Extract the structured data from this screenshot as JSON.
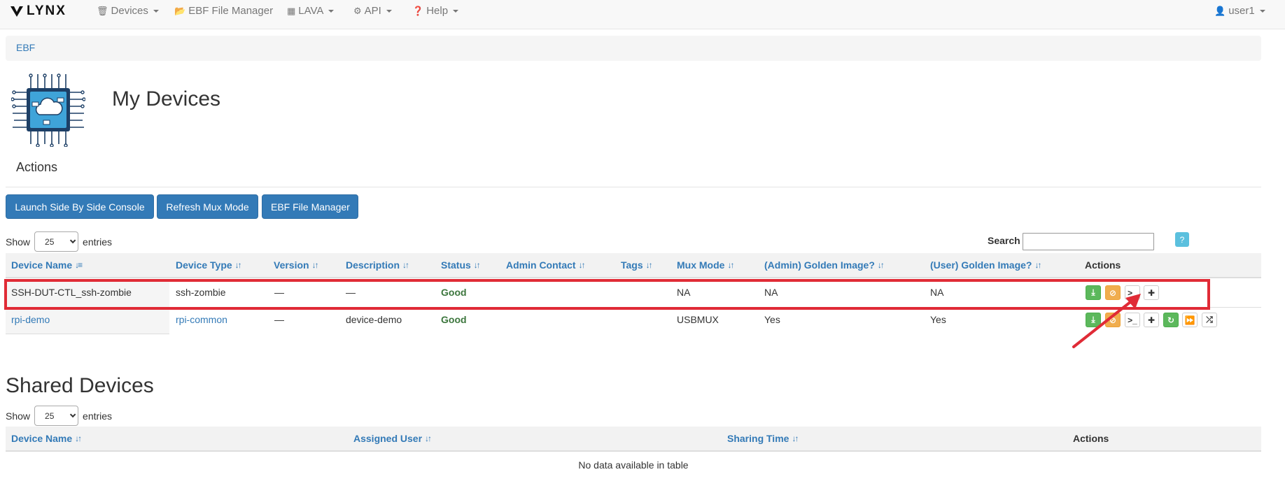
{
  "navbar": {
    "brand": "LYNX",
    "items": [
      {
        "label": "Devices",
        "icon": "trash-icon",
        "dropdown": true
      },
      {
        "label": "EBF File Manager",
        "icon": "folder-open-icon",
        "dropdown": false
      },
      {
        "label": "LAVA",
        "icon": "calendar-icon",
        "dropdown": true
      },
      {
        "label": "API",
        "icon": "gear-icon",
        "dropdown": true
      },
      {
        "label": "Help",
        "icon": "question-circle-icon",
        "dropdown": true
      }
    ],
    "user": "user1"
  },
  "breadcrumb": [
    "EBF"
  ],
  "page_title": "My Devices",
  "actions_heading": "Actions",
  "action_buttons": [
    "Launch Side By Side Console",
    "Refresh Mux Mode",
    "EBF File Manager"
  ],
  "my_devices": {
    "length_prefix": "Show",
    "length_value": "25",
    "length_suffix": "entries",
    "search_label": "Search",
    "search_value": "",
    "help_label": "?",
    "columns": [
      "Device Name",
      "Device Type",
      "Version",
      "Description",
      "Status",
      "Admin Contact",
      "Tags",
      "Mux Mode",
      "(Admin) Golden Image?",
      "(User) Golden Image?",
      "Actions"
    ],
    "rows": [
      {
        "device_name": "SSH-DUT-CTL_ssh-zombie",
        "device_type": "ssh-zombie",
        "version": "—",
        "description": "—",
        "status": "Good",
        "admin_contact": "",
        "tags": "",
        "mux_mode": "NA",
        "admin_golden": "NA",
        "user_golden": "NA",
        "actions": [
          "download-icon",
          "ban-icon",
          "terminal-icon",
          "plus-icon"
        ]
      },
      {
        "device_name": "rpi-demo",
        "device_type": "rpi-common",
        "version": "—",
        "description": "device-demo",
        "status": "Good",
        "admin_contact": "",
        "tags": "",
        "mux_mode": "USBMUX",
        "admin_golden": "Yes",
        "user_golden": "Yes",
        "actions": [
          "download-icon",
          "ban-icon",
          "terminal-icon",
          "plus-icon",
          "refresh-icon",
          "fast-forward-icon",
          "random-icon"
        ]
      }
    ]
  },
  "shared_devices": {
    "title": "Shared Devices",
    "length_prefix": "Show",
    "length_value": "25",
    "length_suffix": "entries",
    "columns": [
      "Device Name",
      "Assigned User",
      "Sharing Time",
      "Actions"
    ],
    "empty_message": "No data available in table"
  },
  "colors": {
    "primary": "#337ab7",
    "success": "#5cb85c",
    "warning": "#f0ad4e",
    "info": "#5bc0de",
    "status_good": "#3c763d",
    "highlight": "#e02b36"
  }
}
